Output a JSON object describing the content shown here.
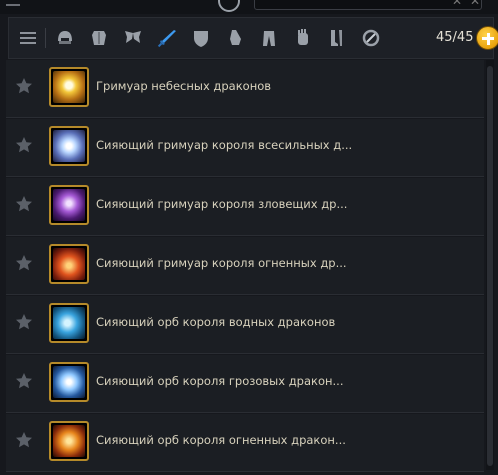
{
  "toolbar": {
    "filters": [
      {
        "icon": "list-icon",
        "active": false
      },
      {
        "icon": "helmet-icon",
        "active": false
      },
      {
        "icon": "chest-armor-icon",
        "active": false
      },
      {
        "icon": "wings-icon",
        "active": false
      },
      {
        "icon": "sword-icon",
        "active": true
      },
      {
        "icon": "shield-icon",
        "active": false
      },
      {
        "icon": "gauntlet-icon",
        "active": false
      },
      {
        "icon": "pants-icon",
        "active": false
      },
      {
        "icon": "gloves-icon",
        "active": false
      },
      {
        "icon": "boots-icon",
        "active": false
      },
      {
        "icon": "ring-icon",
        "active": false
      }
    ],
    "count": "45/45"
  },
  "items": [
    {
      "name": "Гримуар небесных драконов"
    },
    {
      "name": "Сияющий гримуар короля всесильных д..."
    },
    {
      "name": "Сияющий гримуар короля зловещих др..."
    },
    {
      "name": "Сияющий гримуар короля огненных др..."
    },
    {
      "name": "Сияющий орб короля водных драконов"
    },
    {
      "name": "Сияющий орб короля грозовых дракон..."
    },
    {
      "name": "Сияющий орб короля огненных дракон..."
    }
  ],
  "colors": {
    "slot_border": "#b58a2a",
    "accent_blue": "#2f8be0",
    "add_button": "#f2b51c"
  }
}
